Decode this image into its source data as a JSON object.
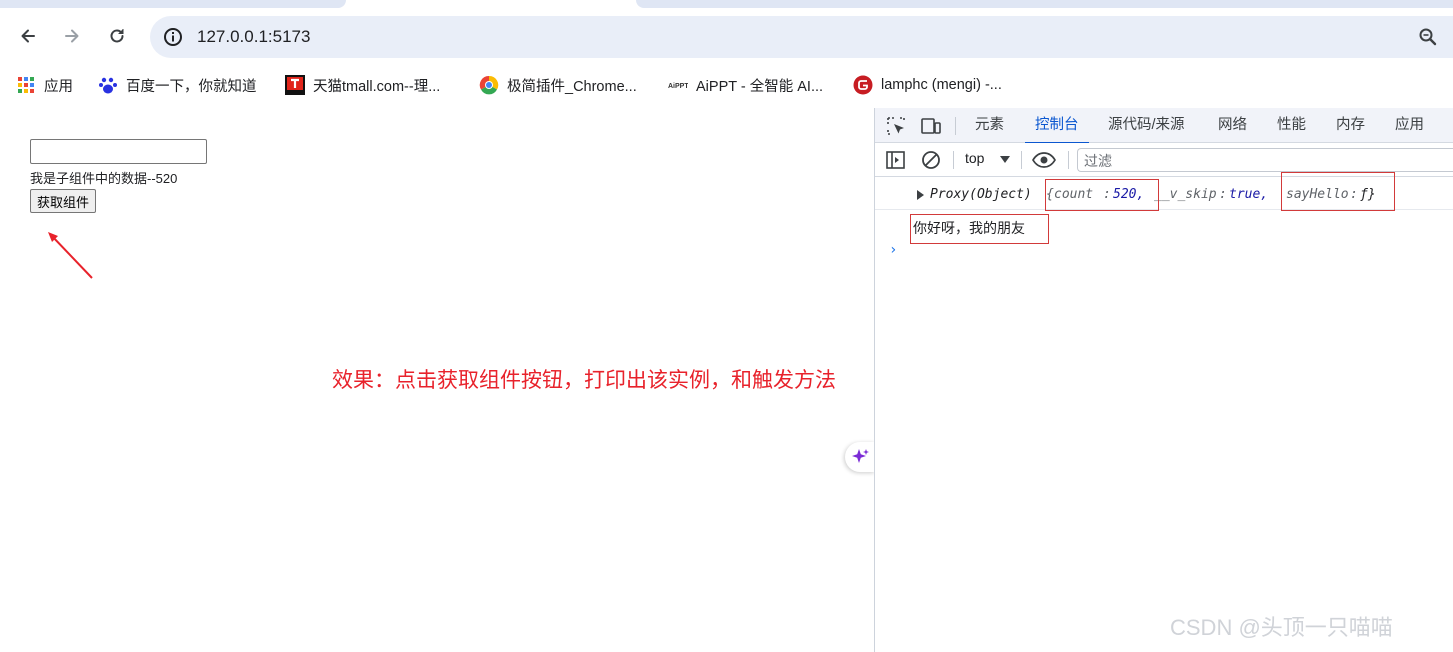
{
  "browser": {
    "url": "127.0.0.1:5173",
    "bookmarks": [
      {
        "label": "应用",
        "icon": "apps-grid-icon"
      },
      {
        "label": "百度一下，你就知道",
        "icon": "baidu-paw-icon"
      },
      {
        "label": "天猫tmall.com--理...",
        "icon": "tmall-icon"
      },
      {
        "label": "极简插件_Chrome...",
        "icon": "chrome-icon"
      },
      {
        "label": "AiPPT - 全智能 AI...",
        "icon": "aippt-icon"
      },
      {
        "label": "lamphc (mengi) -...",
        "icon": "gitee-icon"
      }
    ]
  },
  "page": {
    "input_value": "",
    "child_text": "我是子组件中的数据--520",
    "button_label": "获取组件",
    "effect_text": "效果：点击获取组件按钮，打印出该实例，和触发方法"
  },
  "devtools": {
    "tabs": [
      "元素",
      "控制台",
      "源代码/来源",
      "网络",
      "性能",
      "内存",
      "应用"
    ],
    "active_tab": "控制台",
    "context": "top",
    "filter_placeholder": "过滤",
    "log": {
      "prefix": "Proxy(Object)",
      "brace_open": "{",
      "count_key": "count",
      "count_val": "520,",
      "skip_key": "__v_skip",
      "skip_val": "true,",
      "hello_key": "sayHello",
      "hello_val": "ƒ}",
      "colon": ":"
    },
    "message": "你好呀，我的朋友"
  },
  "watermark": "CSDN @头顶一只喵喵"
}
